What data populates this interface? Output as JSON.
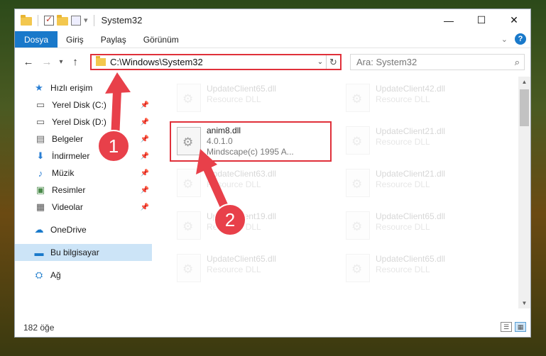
{
  "window": {
    "title": "System32",
    "controls": {
      "minimize": "—",
      "maximize": "☐",
      "close": "✕"
    }
  },
  "ribbon": {
    "tabs": [
      "Dosya",
      "Giriş",
      "Paylaş",
      "Görünüm"
    ],
    "help_label": "?"
  },
  "address": {
    "path": "C:\\Windows\\System32",
    "search_placeholder": "Ara: System32"
  },
  "sidebar": {
    "items": [
      {
        "label": "Hızlı erişim",
        "icon": "star-icon"
      },
      {
        "label": "Yerel Disk (C:)",
        "icon": "drive-icon"
      },
      {
        "label": "Yerel Disk (D:)",
        "icon": "drive-icon"
      },
      {
        "label": "Belgeler",
        "icon": "documents-icon"
      },
      {
        "label": "İndirmeler",
        "icon": "download-icon"
      },
      {
        "label": "Müzik",
        "icon": "music-icon"
      },
      {
        "label": "Resimler",
        "icon": "pictures-icon"
      },
      {
        "label": "Videolar",
        "icon": "videos-icon"
      },
      {
        "label": "OneDrive",
        "icon": "cloud-icon"
      },
      {
        "label": "Bu bilgisayar",
        "icon": "computer-icon"
      },
      {
        "label": "Ağ",
        "icon": "network-icon"
      }
    ]
  },
  "files": {
    "highlighted": {
      "name": "anim8.dll",
      "version": "4.0.1.0",
      "company": "Mindscape(c) 1995 A..."
    },
    "left_column": [
      {
        "name": "UpdateClient65.dll",
        "type": "Resource DLL"
      },
      {
        "name": "UpdateClient63.dll",
        "type": "Resource DLL"
      },
      {
        "name": "UpdateClient19.dll",
        "type": "Resource DLL"
      },
      {
        "name": "UpdateClient65.dll",
        "type": "Resource DLL"
      }
    ],
    "right_column": [
      {
        "name": "UpdateClient42.dll",
        "type": "Resource DLL"
      },
      {
        "name": "UpdateClient21.dll",
        "type": "Resource DLL"
      },
      {
        "name": "UpdateClient21.dll",
        "type": "Resource DLL"
      },
      {
        "name": "UpdateClient65.dll",
        "type": "Resource DLL"
      },
      {
        "name": "UpdateClient65.dll",
        "type": "Resource DLL"
      }
    ]
  },
  "status": {
    "item_count": "182 öğe"
  },
  "annotations": {
    "step1": "1",
    "step2": "2",
    "accent": "#e0303a"
  }
}
